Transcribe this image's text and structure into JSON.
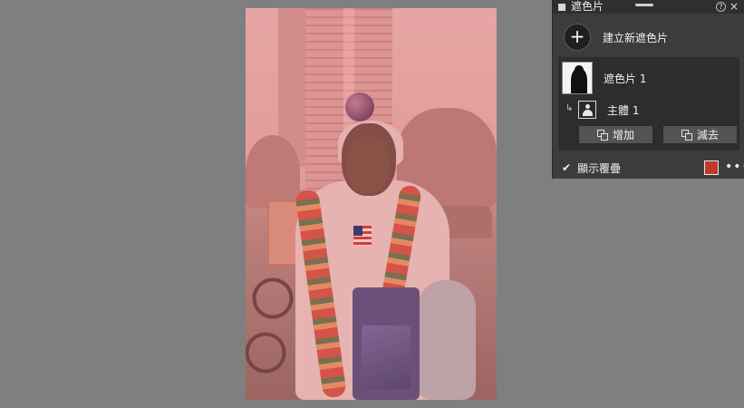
{
  "panel": {
    "title": "遮色片",
    "create_label": "建立新遮色片",
    "create_icon": "+",
    "mask": {
      "name": "遮色片 1"
    },
    "component": {
      "name": "主體 1"
    },
    "add_label": "增加",
    "subtract_label": "減去",
    "help_icon": "?",
    "close_icon": "×",
    "show_overlay": {
      "checked": true,
      "check_glyph": "✔",
      "label": "顯示覆疊"
    },
    "overlay_color": "#c0392b",
    "more_icon": "•••"
  },
  "icons": {
    "panel_square": "square-icon",
    "help": "help-icon",
    "close": "close-icon",
    "plus": "plus-icon",
    "subject": "person-icon",
    "sub_arrow": "corner-arrow-icon",
    "add": "add-mask-icon",
    "subtract": "subtract-mask-icon",
    "more": "more-icon"
  },
  "theme": {
    "background": "#7f7f7f",
    "panel_bg": "#3c3c3c",
    "panel_header": "#2f2f2f",
    "overlay_tint": "#e24d4d"
  }
}
